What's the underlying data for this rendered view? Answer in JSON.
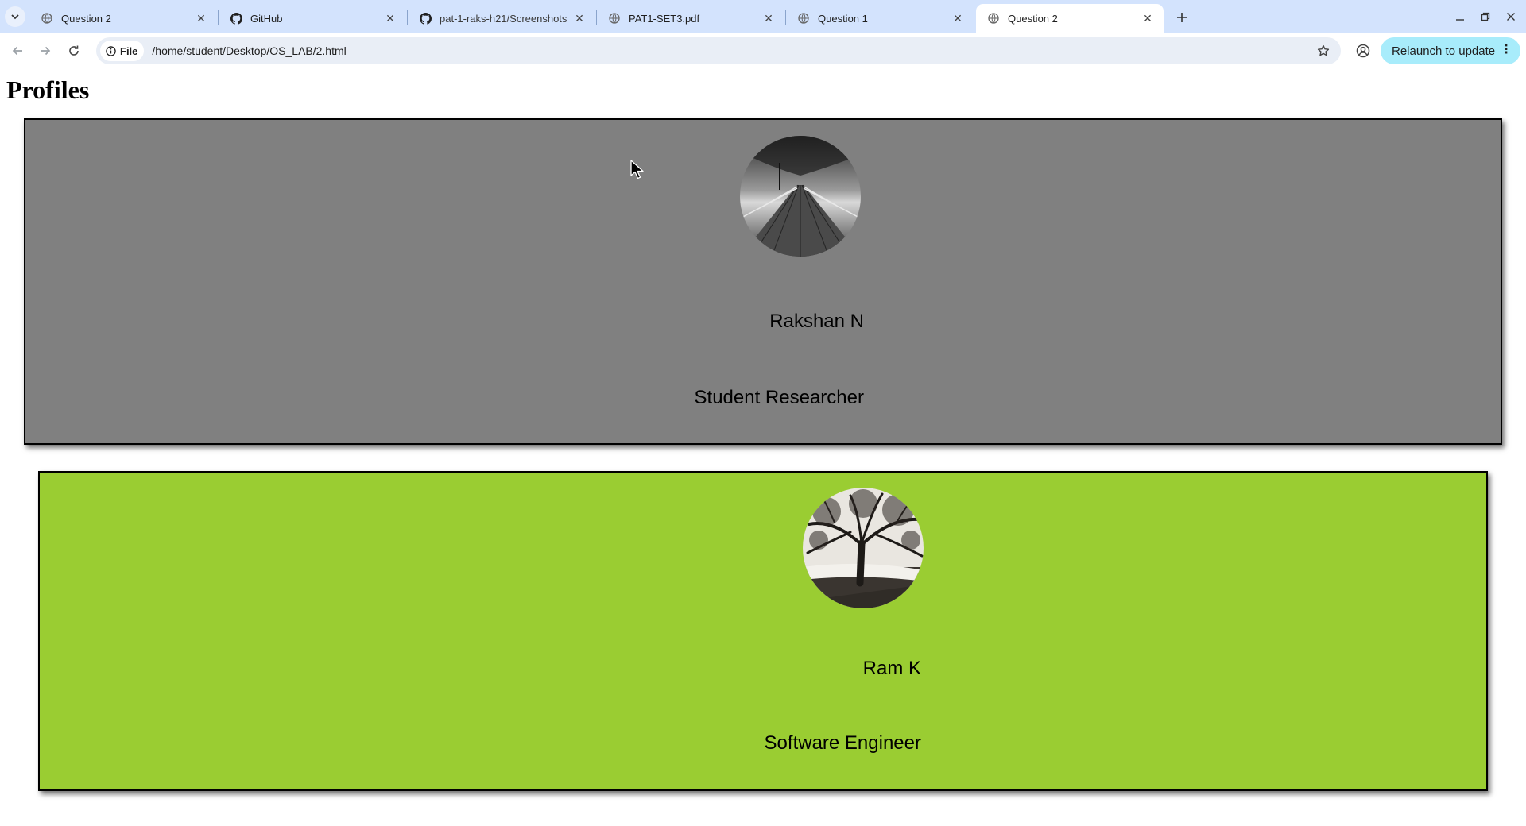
{
  "browser": {
    "tabs": [
      {
        "title": "Question 2",
        "favicon": "globe-icon",
        "active": false
      },
      {
        "title": "GitHub",
        "favicon": "github-icon",
        "active": false
      },
      {
        "title": "pat-1-raks-h21/Screenshots",
        "favicon": "github-icon",
        "active": false
      },
      {
        "title": "PAT1-SET3.pdf",
        "favicon": "globe-icon",
        "active": false
      },
      {
        "title": "Question 1",
        "favicon": "globe-icon",
        "active": false
      },
      {
        "title": "Question 2",
        "favicon": "globe-icon",
        "active": true
      }
    ],
    "address": {
      "chip_label": "File",
      "url": "/home/student/Desktop/OS_LAB/2.html"
    },
    "relaunch_label": "Relaunch to update",
    "colors": {
      "tabstrip": "#d3e3fd",
      "omnibox": "#e9eef6",
      "relaunch": "#a8ecfb"
    }
  },
  "page": {
    "title": "Profiles",
    "profiles": [
      {
        "name": "Rakshan N",
        "role": "Student Researcher",
        "card_color": "#808080",
        "photo": "pier-photo"
      },
      {
        "name": "Ram K",
        "role": "Software Engineer",
        "card_color": "#9acd32",
        "photo": "tree-photo"
      }
    ]
  }
}
